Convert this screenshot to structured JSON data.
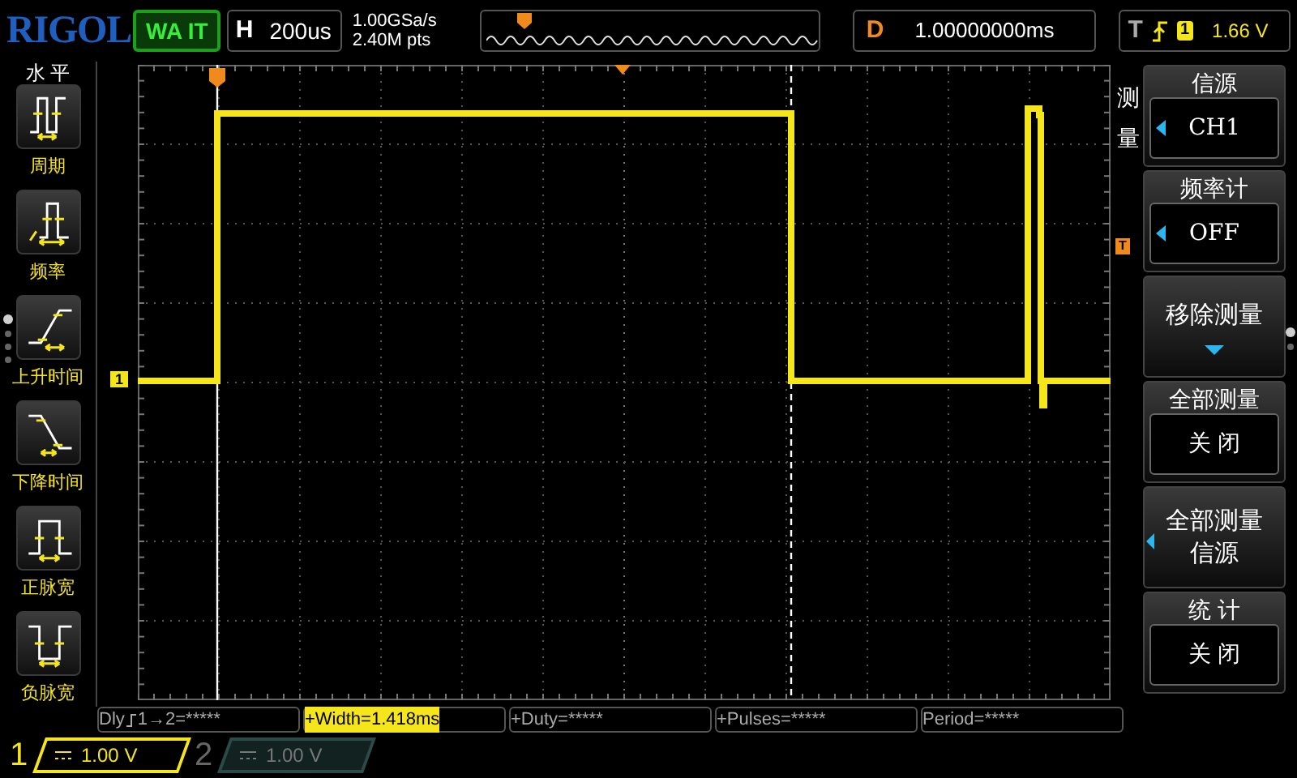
{
  "header": {
    "logo": "RIGOL",
    "run_state": "WA IT",
    "timebase": {
      "label": "H",
      "value": "200us"
    },
    "sample_rate": "1.00GSa/s",
    "memory_depth": "2.40M pts",
    "delay": {
      "label": "D",
      "value": "1.00000000ms"
    },
    "trigger": {
      "label": "T",
      "source": "1",
      "level": "1.66 V"
    }
  },
  "left_menu": {
    "title": "水 平",
    "page_dots": [
      {
        "selected": true
      },
      {
        "selected": false
      },
      {
        "selected": false
      },
      {
        "selected": false
      }
    ],
    "items": [
      {
        "kind": "period",
        "label": "周期"
      },
      {
        "kind": "frequency",
        "label": "频率"
      },
      {
        "kind": "rise",
        "label": "上升时间"
      },
      {
        "kind": "fall",
        "label": "下降时间"
      },
      {
        "kind": "pos_width",
        "label": "正脉宽"
      },
      {
        "kind": "neg_width",
        "label": "负脉宽"
      }
    ]
  },
  "plot": {
    "channel_marker": "1",
    "trigger_marker": "T"
  },
  "right_menu": {
    "title": "测量",
    "page_dots": [
      {
        "selected": true
      },
      {
        "selected": false
      }
    ],
    "items": [
      {
        "kind": "select",
        "title": "信源",
        "value": "CH1"
      },
      {
        "kind": "select",
        "title": "频率计",
        "value": "OFF"
      },
      {
        "kind": "action",
        "title": "移除测量"
      },
      {
        "kind": "value",
        "title": "全部测量",
        "value": "关 闭"
      },
      {
        "kind": "submenu",
        "lines": [
          "全部测量",
          "信源"
        ]
      },
      {
        "kind": "value",
        "title": "统 计",
        "value": "关 闭"
      }
    ]
  },
  "measurements": [
    {
      "prefix": "Dly",
      "label": "1→2=*****",
      "selected": false
    },
    {
      "label": "+Width=1.418ms",
      "selected": true
    },
    {
      "label": "+Duty=*****",
      "selected": false
    },
    {
      "label": "+Pulses=*****",
      "selected": false
    },
    {
      "label": "Period=*****",
      "selected": false
    }
  ],
  "channels": [
    {
      "number": "1",
      "scale": "1.00 V",
      "on": true
    },
    {
      "number": "2",
      "scale": "1.00 V",
      "on": false
    }
  ]
}
